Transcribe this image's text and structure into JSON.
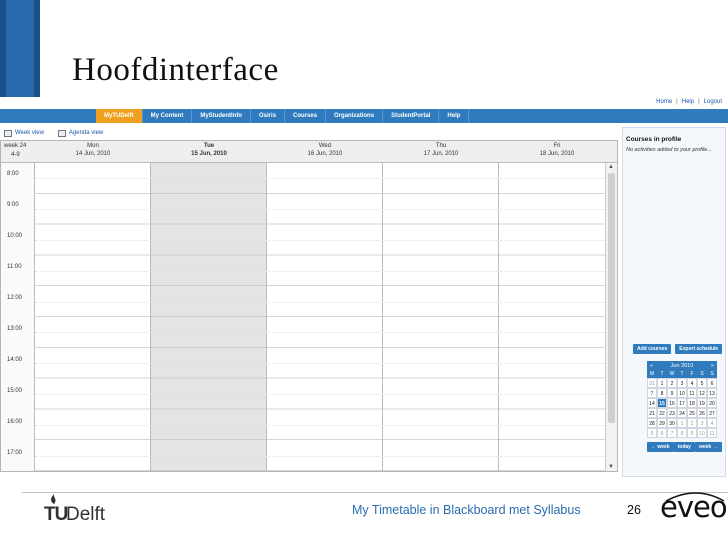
{
  "slide": {
    "title": "Hoofdinterface",
    "footer_text": "My Timetable in Blackboard met Syllabus",
    "page_number": "26",
    "logo_left": {
      "tu": "TU",
      "delft": "Delft"
    },
    "logo_right": "eveoh"
  },
  "app": {
    "toplinks": [
      "Home",
      "Help",
      "Logout"
    ],
    "nav": [
      "MyTUDelft",
      "My Content",
      "MyStudentInfo",
      "Osiris",
      "Courses",
      "Organizations",
      "StudentPortal",
      "Help"
    ],
    "active_nav_index": 0,
    "views": [
      "Week view",
      "Agenda view"
    ],
    "calendar": {
      "week_label": "week 24",
      "week_range": "4-9",
      "days": [
        {
          "name": "Mon",
          "date": "14 Jun, 2010"
        },
        {
          "name": "Tue",
          "date": "15 Jun, 2010"
        },
        {
          "name": "Wed",
          "date": "16 Jun, 2010"
        },
        {
          "name": "Thu",
          "date": "17 Jun, 2010"
        },
        {
          "name": "Fri",
          "date": "18 Jun, 2010"
        }
      ],
      "today_index": 1,
      "times": [
        "8:00",
        "9:00",
        "10:00",
        "11:00",
        "12:00",
        "13:00",
        "14:00",
        "15:00",
        "16:00",
        "17:00"
      ]
    },
    "side": {
      "title": "Courses in profile",
      "note": "No activities added to your profile...",
      "buttons": [
        "Add courses",
        "Export schedule"
      ],
      "mini_calendar": {
        "month_label": "Jun 2010",
        "prev": "«",
        "next": "»",
        "dow": [
          "M",
          "T",
          "W",
          "T",
          "F",
          "S",
          "S"
        ],
        "days": [
          "31",
          "1",
          "2",
          "3",
          "4",
          "5",
          "6",
          "7",
          "8",
          "9",
          "10",
          "11",
          "12",
          "13",
          "14",
          "15",
          "16",
          "17",
          "18",
          "19",
          "20",
          "21",
          "22",
          "23",
          "24",
          "25",
          "26",
          "27",
          "28",
          "29",
          "30",
          "1",
          "2",
          "3",
          "4",
          "5",
          "6",
          "7",
          "8",
          "9",
          "10",
          "11"
        ],
        "out_of_month_indices": [
          0,
          31,
          32,
          33,
          34,
          35,
          36,
          37,
          38,
          39,
          40,
          41
        ],
        "selected_index": 15,
        "nav_buttons": [
          "← week",
          "today",
          "week →"
        ]
      }
    }
  },
  "colors": {
    "brand_blue": "#2f7bbd",
    "active_tab": "#f0a020",
    "today_column": "#e4e4e4"
  }
}
